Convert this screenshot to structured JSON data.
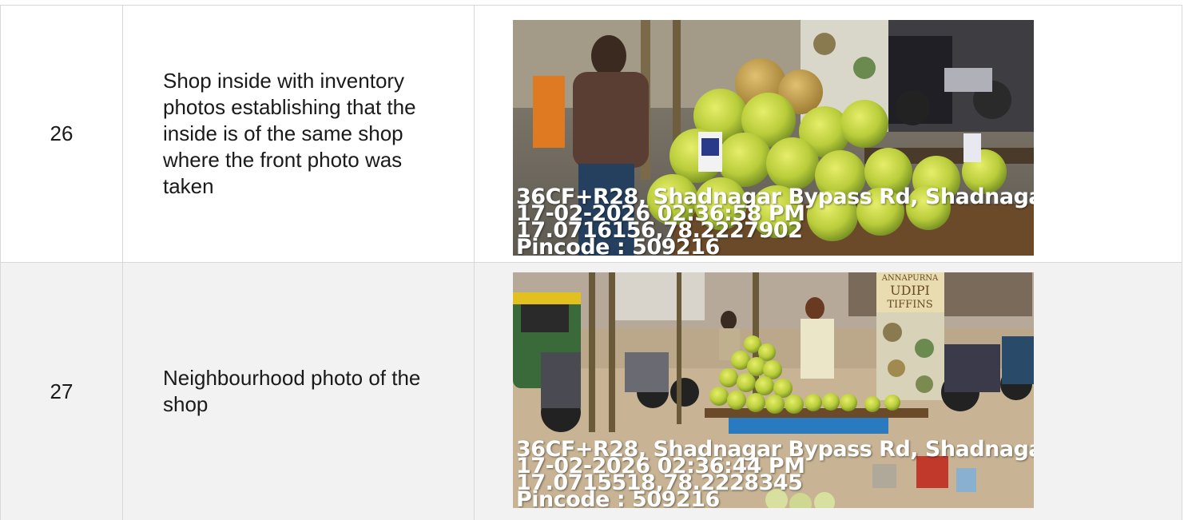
{
  "rows": [
    {
      "number": "26",
      "description": "Shop inside with inventory photos establishing that the inside is of the same shop where the front photo was taken",
      "photo": {
        "address": "36CF+R28, Shadnagar Bypass Rd, Shadnaga",
        "datetime": "17-02-2026 02:36:58 PM",
        "coords": "17.0716156,78.2227902",
        "pincode": "Pincode : 509216"
      }
    },
    {
      "number": "27",
      "description": "Neighbourhood photo of the shop",
      "photo": {
        "address": "36CF+R28, Shadnagar Bypass Rd, Shadnaga",
        "datetime": "17-02-2026 02:36:44 PM",
        "coords": "17.0715518,78.2228345",
        "pincode": "Pincode : 509216",
        "sign_text": "ANNAPURNA UDIPI TIFFINS"
      }
    }
  ]
}
